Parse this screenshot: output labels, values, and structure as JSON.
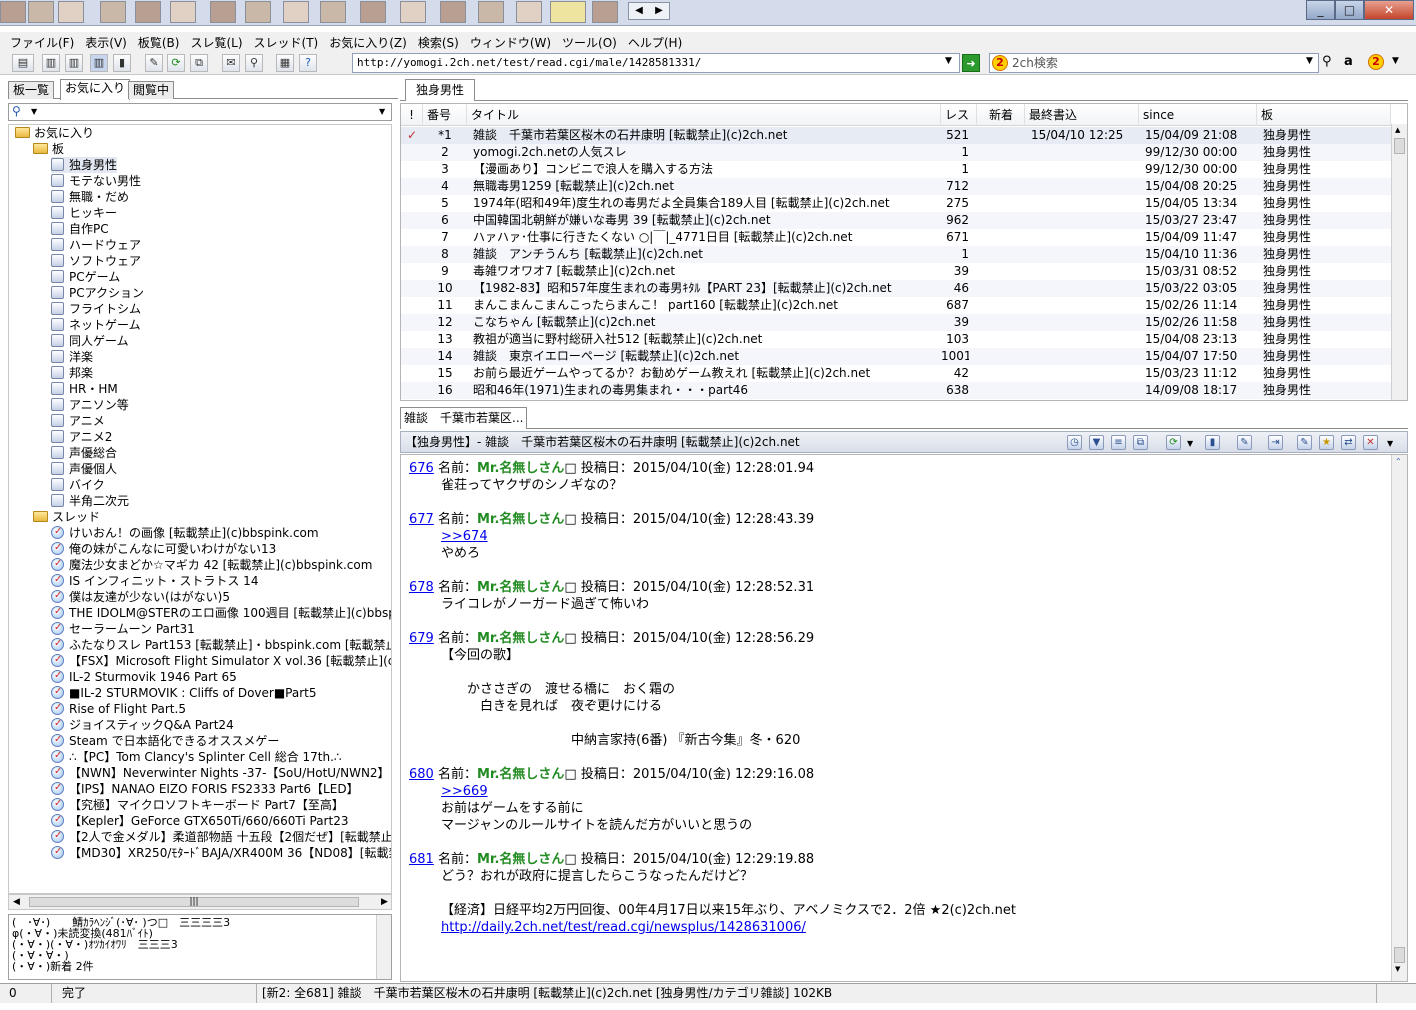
{
  "menu": [
    "ファイル(F)",
    "表示(V)",
    "板覧(B)",
    "スレ覧(L)",
    "スレッド(T)",
    "お気に入り(Z)",
    "検索(S)",
    "ウィンドウ(W)",
    "ツール(O)",
    "ヘルプ(H)"
  ],
  "toolbar": {
    "url": "http://yomogi.2ch.net/test/read.cgi/male/1428581331/",
    "search_engine": "2ch検索"
  },
  "left_tabs": [
    "板一覧",
    "お気に入り",
    "閲覧中"
  ],
  "tree": {
    "root": "お気に入り",
    "boards_folder": "板",
    "boards": [
      "独身男性",
      "モテない男性",
      "無職・だめ",
      "ヒッキー",
      "自作PC",
      "ハードウェア",
      "ソフトウェア",
      "PCゲーム",
      "PCアクション",
      "フライトシム",
      "ネットゲーム",
      "同人ゲーム",
      "洋楽",
      "邦楽",
      "HR・HM",
      "アニソン等",
      "アニメ",
      "アニメ2",
      "声優総合",
      "声優個人",
      "バイク",
      "半角二次元"
    ],
    "threads_folder": "スレッド",
    "threads": [
      "けいおん！の画像 [転載禁止](c)bbspink.com",
      "俺の妹がこんなに可愛いわけがない13",
      "魔法少女まどか☆マギカ 42 [転載禁止](c)bbspink.com",
      "IS インフィニット・ストラトス 14",
      "僕は友達が少ない(はがない)5",
      "THE IDOLM@STERのエロ画像 100週目 [転載禁止](c)bbsp",
      "セーラームーン Part31",
      "ふたなりスレ Part153 [転載禁止]・bbspink.com [転載禁止]",
      "【FSX】Microsoft Flight Simulator X vol.36 [転載禁止](c)2",
      "IL-2 Sturmovik 1946 Part 65",
      "■IL-2 STURMOVIK : Cliffs of Dover■Part5",
      "Rise of Flight Part.5",
      "ジョイスティックQ&A Part24",
      "Steam で日本語化できるオススメゲー",
      "∴【PC】Tom Clancy's Splinter Cell 総合 17th.∴",
      "【NWN】Neverwinter Nights -37-【SoU/HotU/NWN2】",
      "【IPS】NANAO EIZO FORIS FS2333 Part6【LED】",
      "【究極】マイクロソフトキーボード Part7【至高】",
      "【Kepler】GeForce GTX650Ti/660/660Ti Part23",
      "【2人で金メダル】柔道部物語 十五段【2個だぜ】[転載禁止]",
      "【MD30】XR250/ﾓﾀｰﾄﾞBAJA/XR400M 36【ND08】[転載禁止]"
    ]
  },
  "log": [
    "(　･∀･)　　鯖ｶﾗﾍﾝｼﾞ(･∀･ )つ□　三三三三3",
    "φ(・∀・)未読変換(481ﾊﾞｲﾄ)",
    "(・∀・)(・∀・)ｵﾂｶｲｵﾜﾘ　三三三3",
    "(・∀・∀・)",
    "(・∀・)新着 2件"
  ],
  "status": {
    "left": "0",
    "state": "完了",
    "message": "[新2: 全681] 雑談　千葉市若葉区桜木の石井康明 [転載禁止](c)2ch.net [独身男性/カテゴリ雑談] 102KB"
  },
  "board_tab": "独身男性",
  "list_columns": [
    "!",
    "番号",
    "タイトル",
    "レス",
    "新着",
    "最終書込",
    "since",
    "板"
  ],
  "threads": [
    {
      "mark": "✓",
      "no": "*1",
      "title": "雑談　千葉市若葉区桜木の石井康明 [転載禁止](c)2ch.net",
      "res": "521",
      "new": "",
      "last": "15/04/10 12:25",
      "since": "15/04/09 21:08",
      "board": "独身男性"
    },
    {
      "mark": "",
      "no": "2",
      "title": "yomogi.2ch.netの人気スレ",
      "res": "1",
      "new": "",
      "last": "",
      "since": "99/12/30 00:00",
      "board": "独身男性"
    },
    {
      "mark": "",
      "no": "3",
      "title": "【漫画あり】コンビニで浪人を購入する方法",
      "res": "1",
      "new": "",
      "last": "",
      "since": "99/12/30 00:00",
      "board": "独身男性"
    },
    {
      "mark": "",
      "no": "4",
      "title": "無職毒男1259 [転載禁止](c)2ch.net",
      "res": "712",
      "new": "",
      "last": "",
      "since": "15/04/08 20:25",
      "board": "独身男性"
    },
    {
      "mark": "",
      "no": "5",
      "title": "1974年(昭和49年)度生れの毒男だよ全員集合189人目 [転載禁止](c)2ch.net",
      "res": "275",
      "new": "",
      "last": "",
      "since": "15/04/05 13:34",
      "board": "独身男性"
    },
    {
      "mark": "",
      "no": "6",
      "title": "中国韓国北朝鮮が嫌いな毒男 39 [転載禁止](c)2ch.net",
      "res": "962",
      "new": "",
      "last": "",
      "since": "15/03/27 23:47",
      "board": "独身男性"
    },
    {
      "mark": "",
      "no": "7",
      "title": "ハァハァ･仕事に行きたくない ○|￣|_4771日目 [転載禁止](c)2ch.net",
      "res": "671",
      "new": "",
      "last": "",
      "since": "15/04/09 11:47",
      "board": "独身男性"
    },
    {
      "mark": "",
      "no": "8",
      "title": "雑談　アンチうんち [転載禁止](c)2ch.net",
      "res": "1",
      "new": "",
      "last": "",
      "since": "15/04/10 11:36",
      "board": "独身男性"
    },
    {
      "mark": "",
      "no": "9",
      "title": "毒雑ワオワオ7 [転載禁止](c)2ch.net",
      "res": "39",
      "new": "",
      "last": "",
      "since": "15/03/31 08:52",
      "board": "独身男性"
    },
    {
      "mark": "",
      "no": "10",
      "title": "【1982-83】昭和57年度生まれの毒男ｷﾀﾙ【PART 23】[転載禁止](c)2ch.net",
      "res": "46",
      "new": "",
      "last": "",
      "since": "15/03/22 03:05",
      "board": "独身男性"
    },
    {
      "mark": "",
      "no": "11",
      "title": "まんこまんこまんこったらまんこ！ part160 [転載禁止](c)2ch.net",
      "res": "687",
      "new": "",
      "last": "",
      "since": "15/02/26 11:14",
      "board": "独身男性"
    },
    {
      "mark": "",
      "no": "12",
      "title": "こなちゃん [転載禁止](c)2ch.net",
      "res": "39",
      "new": "",
      "last": "",
      "since": "15/02/26 11:58",
      "board": "独身男性"
    },
    {
      "mark": "",
      "no": "13",
      "title": "教祖が適当に野村総研入社512 [転載禁止](c)2ch.net",
      "res": "103",
      "new": "",
      "last": "",
      "since": "15/04/08 23:13",
      "board": "独身男性"
    },
    {
      "mark": "",
      "no": "14",
      "title": "雑談　東京イエローページ [転載禁止](c)2ch.net",
      "res": "1001",
      "new": "",
      "last": "",
      "since": "15/04/07 17:50",
      "board": "独身男性"
    },
    {
      "mark": "",
      "no": "15",
      "title": "お前ら最近ゲームやってるか？お勧めゲーム教えれ [転載禁止](c)2ch.net",
      "res": "42",
      "new": "",
      "last": "",
      "since": "15/03/23 11:12",
      "board": "独身男性"
    },
    {
      "mark": "",
      "no": "16",
      "title": "昭和46年(1971)生まれの毒男集まれ・・・part46",
      "res": "638",
      "new": "",
      "last": "",
      "since": "14/09/08 18:17",
      "board": "独身男性"
    }
  ],
  "thread_tab": "雑談　千葉市若葉区...",
  "thread_header": "【独身男性】- 雑談　千葉市若葉区桜木の石井康明 [転載禁止](c)2ch.net",
  "posts": [
    {
      "num": "676",
      "label": "名前：",
      "name": "Mr.名無しさん",
      "date": "投稿日：2015/04/10(金) 12:28:01.94",
      "lines": [
        "雀荘ってヤクザのシノギなの？"
      ]
    },
    {
      "num": "677",
      "label": "名前：",
      "name": "Mr.名無しさん",
      "date": "投稿日：2015/04/10(金) 12:28:43.39",
      "anchor": ">>674",
      "lines": [
        "やめろ"
      ]
    },
    {
      "num": "678",
      "label": "名前：",
      "name": "Mr.名無しさん",
      "date": "投稿日：2015/04/10(金) 12:28:52.31",
      "lines": [
        "ライコレがノーガード過ぎて怖いわ"
      ]
    },
    {
      "num": "679",
      "label": "名前：",
      "name": "Mr.名無しさん",
      "date": "投稿日：2015/04/10(金) 12:28:56.29",
      "lines": [
        "【今回の歌】",
        "",
        "　　かささぎの　渡せる橋に　おく霜の",
        "　　　白きを見れば　夜ぞ更けにける",
        "",
        "　　　　　　　　　　中納言家持(6番) 『新古今集』冬・620"
      ]
    },
    {
      "num": "680",
      "label": "名前：",
      "name": "Mr.名無しさん",
      "date": "投稿日：2015/04/10(金) 12:29:16.08",
      "anchor": ">>669",
      "lines": [
        "お前はゲームをする前に",
        "マージャンのルールサイトを読んだ方がいいと思うの"
      ]
    },
    {
      "num": "681",
      "label": "名前：",
      "name": "Mr.名無しさん",
      "date": "投稿日：2015/04/10(金) 12:29:19.88",
      "lines": [
        "どう？おれが政府に提言したらこうなったんだけど？",
        "",
        "【経済】日経平均2万円回復、00年4月17日以来15年ぶり、アベノミクスで2．2倍 ★2(c)2ch.net"
      ],
      "url": "http://daily.2ch.net/test/read.cgi/newsplus/1428631006/"
    }
  ]
}
